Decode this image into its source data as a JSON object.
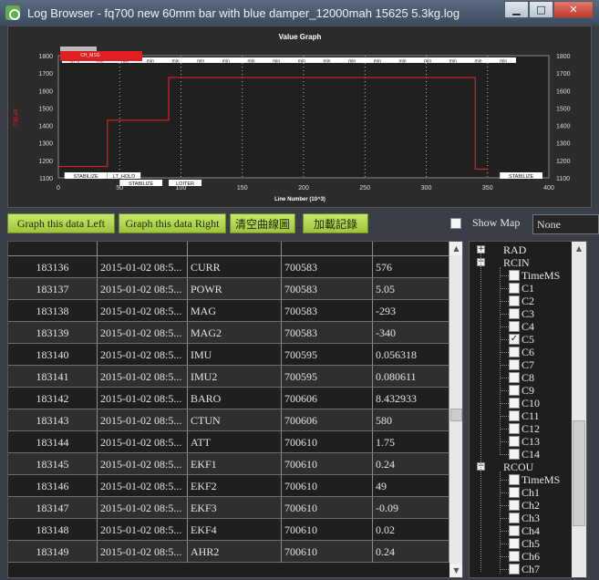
{
  "window": {
    "title": "Log Browser - fq700 new 60mm bar with blue damper_12000mah  15625 5.3kg.log",
    "minimize": "▁",
    "maximize": "□",
    "close": "✕"
  },
  "graph": {
    "title": "Value Graph",
    "left_axis_label": "C5|Left",
    "x_label": "Line Number (10^3)",
    "x_ticks": [
      "0",
      "50",
      "100",
      "150",
      "200",
      "250",
      "300",
      "350",
      "400"
    ],
    "y_ticks": [
      "1100",
      "1200",
      "1300",
      "1400",
      "1500",
      "1600",
      "1700",
      "1800"
    ],
    "y_ticks_right": [
      "1100",
      "1200",
      "1300",
      "1400",
      "1500",
      "1600",
      "1700",
      "1800"
    ],
    "legend_label": "CH_MSG",
    "top_markers": [
      "GPS",
      "min",
      "min",
      "min",
      "min",
      "min",
      "min",
      "min",
      "min",
      "min",
      "min",
      "min",
      "min",
      "min",
      "min",
      "min",
      "min",
      "min"
    ],
    "mode_labels": [
      "STABILIZE",
      "LT_HOLD",
      "STABILIZE",
      "LOITER",
      "STABILIZE"
    ],
    "colors": {
      "line": "#e02020",
      "background": "#202020",
      "grid": "#bdbdbd"
    }
  },
  "chart_data": {
    "type": "line",
    "title": "Value Graph",
    "xlabel": "Line Number (10^3)",
    "ylabel": "C5|Left",
    "xlim": [
      0,
      400
    ],
    "ylim": [
      1100,
      1800
    ],
    "grid": true,
    "series": [
      {
        "name": "C5",
        "x": [
          0,
          40,
          40,
          90,
          90,
          340,
          340,
          350
        ],
        "y": [
          1165,
          1165,
          1430,
          1430,
          1675,
          1675,
          1150,
          1150
        ]
      }
    ]
  },
  "toolbar": {
    "graph_left": "Graph this data Left",
    "graph_right": "Graph this data Right",
    "clear_graph": "清空曲線圖",
    "load_log": "加載記錄",
    "show_map": "Show Map",
    "map_select": "None"
  },
  "table": {
    "rows": [
      [
        "183136",
        "2015-01-02 08:5...",
        "CURR",
        "700583",
        "576"
      ],
      [
        "183137",
        "2015-01-02 08:5...",
        "POWR",
        "700583",
        "5.05"
      ],
      [
        "183138",
        "2015-01-02 08:5...",
        "MAG",
        "700583",
        "-293"
      ],
      [
        "183139",
        "2015-01-02 08:5...",
        "MAG2",
        "700583",
        "-340"
      ],
      [
        "183140",
        "2015-01-02 08:5...",
        "IMU",
        "700595",
        "0.056318"
      ],
      [
        "183141",
        "2015-01-02 08:5...",
        "IMU2",
        "700595",
        "0.080611"
      ],
      [
        "183142",
        "2015-01-02 08:5...",
        "BARO",
        "700606",
        "8.432933"
      ],
      [
        "183143",
        "2015-01-02 08:5...",
        "CTUN",
        "700606",
        "580"
      ],
      [
        "183144",
        "2015-01-02 08:5...",
        "ATT",
        "700610",
        "1.75"
      ],
      [
        "183145",
        "2015-01-02 08:5...",
        "EKF1",
        "700610",
        "0.24"
      ],
      [
        "183146",
        "2015-01-02 08:5...",
        "EKF2",
        "700610",
        "49"
      ],
      [
        "183147",
        "2015-01-02 08:5...",
        "EKF3",
        "700610",
        "-0.09"
      ],
      [
        "183148",
        "2015-01-02 08:5...",
        "EKF4",
        "700610",
        "0.02"
      ],
      [
        "183149",
        "2015-01-02 08:5...",
        "AHR2",
        "700610",
        "0.24"
      ]
    ]
  },
  "tree": {
    "nodes": [
      {
        "label": "RAD",
        "expander": "+",
        "level": 0
      },
      {
        "label": "RCIN",
        "expander": "−",
        "level": 0
      },
      {
        "label": "TimeMS",
        "checked": false,
        "level": 1
      },
      {
        "label": "C1",
        "checked": false,
        "level": 1
      },
      {
        "label": "C2",
        "checked": false,
        "level": 1
      },
      {
        "label": "C3",
        "checked": false,
        "level": 1
      },
      {
        "label": "C4",
        "checked": false,
        "level": 1
      },
      {
        "label": "C5",
        "checked": true,
        "level": 1
      },
      {
        "label": "C6",
        "checked": false,
        "level": 1
      },
      {
        "label": "C7",
        "checked": false,
        "level": 1
      },
      {
        "label": "C8",
        "checked": false,
        "level": 1
      },
      {
        "label": "C9",
        "checked": false,
        "level": 1
      },
      {
        "label": "C10",
        "checked": false,
        "level": 1
      },
      {
        "label": "C11",
        "checked": false,
        "level": 1
      },
      {
        "label": "C12",
        "checked": false,
        "level": 1
      },
      {
        "label": "C13",
        "checked": false,
        "level": 1
      },
      {
        "label": "C14",
        "checked": false,
        "level": 1
      },
      {
        "label": "RCOU",
        "expander": "−",
        "level": 0
      },
      {
        "label": "TimeMS",
        "checked": false,
        "level": 1
      },
      {
        "label": "Ch1",
        "checked": false,
        "level": 1
      },
      {
        "label": "Ch2",
        "checked": false,
        "level": 1
      },
      {
        "label": "Ch3",
        "checked": false,
        "level": 1
      },
      {
        "label": "Ch4",
        "checked": false,
        "level": 1
      },
      {
        "label": "Ch5",
        "checked": false,
        "level": 1
      },
      {
        "label": "Ch6",
        "checked": false,
        "level": 1
      },
      {
        "label": "Ch7",
        "checked": false,
        "level": 1
      }
    ]
  }
}
